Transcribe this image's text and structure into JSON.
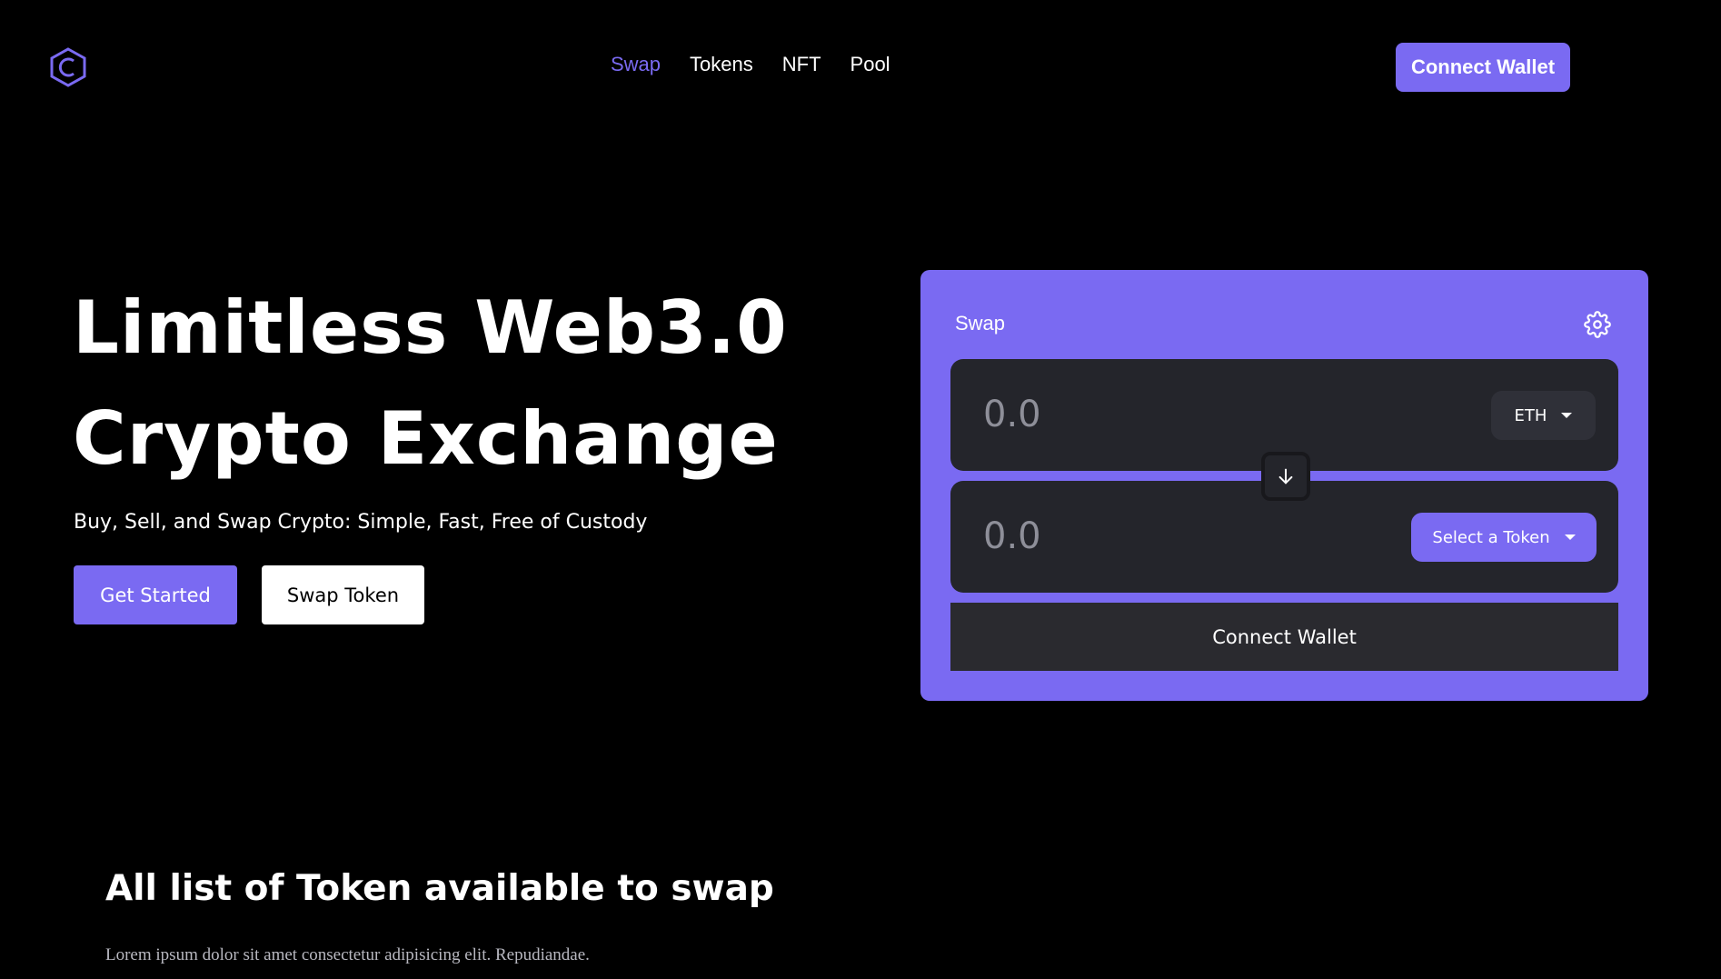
{
  "header": {
    "logo_icon": "hexagon-c-logo-icon",
    "nav": [
      {
        "label": "Swap",
        "active": true
      },
      {
        "label": "Tokens",
        "active": false
      },
      {
        "label": "NFT",
        "active": false
      },
      {
        "label": "Pool",
        "active": false
      }
    ],
    "connect_label": "Connect Wallet"
  },
  "hero": {
    "title_line1": "Limitless Web3.0",
    "title_line2": "Crypto Exchange",
    "subtitle": "Buy, Sell, and Swap Crypto: Simple, Fast, Free of Custody",
    "primary_label": "Get Started",
    "secondary_label": "Swap Token"
  },
  "swap": {
    "title": "Swap",
    "settings_icon": "gear-icon",
    "from": {
      "placeholder": "0.0",
      "token": "ETH"
    },
    "to": {
      "placeholder": "0.0",
      "token": "Select a Token"
    },
    "switch_icon": "arrow-down-icon",
    "connect_label": "Connect Wallet"
  },
  "token_list": {
    "heading": "All list of Token available to swap",
    "description": "Lorem ipsum dolor sit amet consectetur adipisicing elit. Repudiandae."
  },
  "colors": {
    "accent": "#7a6af2",
    "background": "#000000",
    "panel": "#24252b"
  }
}
